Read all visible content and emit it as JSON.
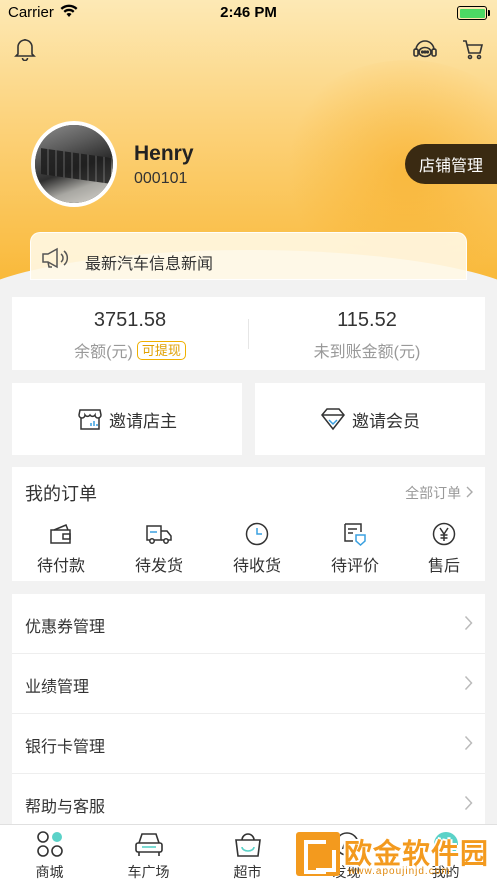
{
  "status_bar": {
    "carrier": "Carrier",
    "time": "2:46 PM"
  },
  "profile": {
    "name": "Henry",
    "id": "000101",
    "store_button": "店铺管理"
  },
  "notice": {
    "text": "最新汽车信息新闻"
  },
  "balance": {
    "amount": "3751.58",
    "amount_label": "余额(元)",
    "withdraw_tag": "可提现",
    "pending": "115.52",
    "pending_label": "未到账金额(元)"
  },
  "invite": {
    "shop_owner": "邀请店主",
    "member": "邀请会员"
  },
  "orders": {
    "title": "我的订单",
    "all_link": "全部订单",
    "items": [
      {
        "label": "待付款",
        "icon": "wallet-icon"
      },
      {
        "label": "待发货",
        "icon": "truck-icon"
      },
      {
        "label": "待收货",
        "icon": "clock-icon"
      },
      {
        "label": "待评价",
        "icon": "review-icon"
      },
      {
        "label": "售后",
        "icon": "yen-icon"
      }
    ]
  },
  "menu": [
    {
      "label": "优惠券管理"
    },
    {
      "label": "业绩管理"
    },
    {
      "label": "银行卡管理"
    },
    {
      "label": "帮助与客服"
    }
  ],
  "tabbar": [
    {
      "label": "商城",
      "icon": "mall-icon"
    },
    {
      "label": "车广场",
      "icon": "car-icon"
    },
    {
      "label": "超市",
      "icon": "basket-icon"
    },
    {
      "label": "发现",
      "icon": "discover-icon"
    },
    {
      "label": "我的",
      "icon": "profile-icon"
    }
  ],
  "watermark": {
    "text": "欧金软件园",
    "url": "www.apoujinjd.com"
  },
  "colors": {
    "accent": "#f9b93a",
    "store_button_bg": "#3a2a12",
    "tag": "#f0b000"
  }
}
